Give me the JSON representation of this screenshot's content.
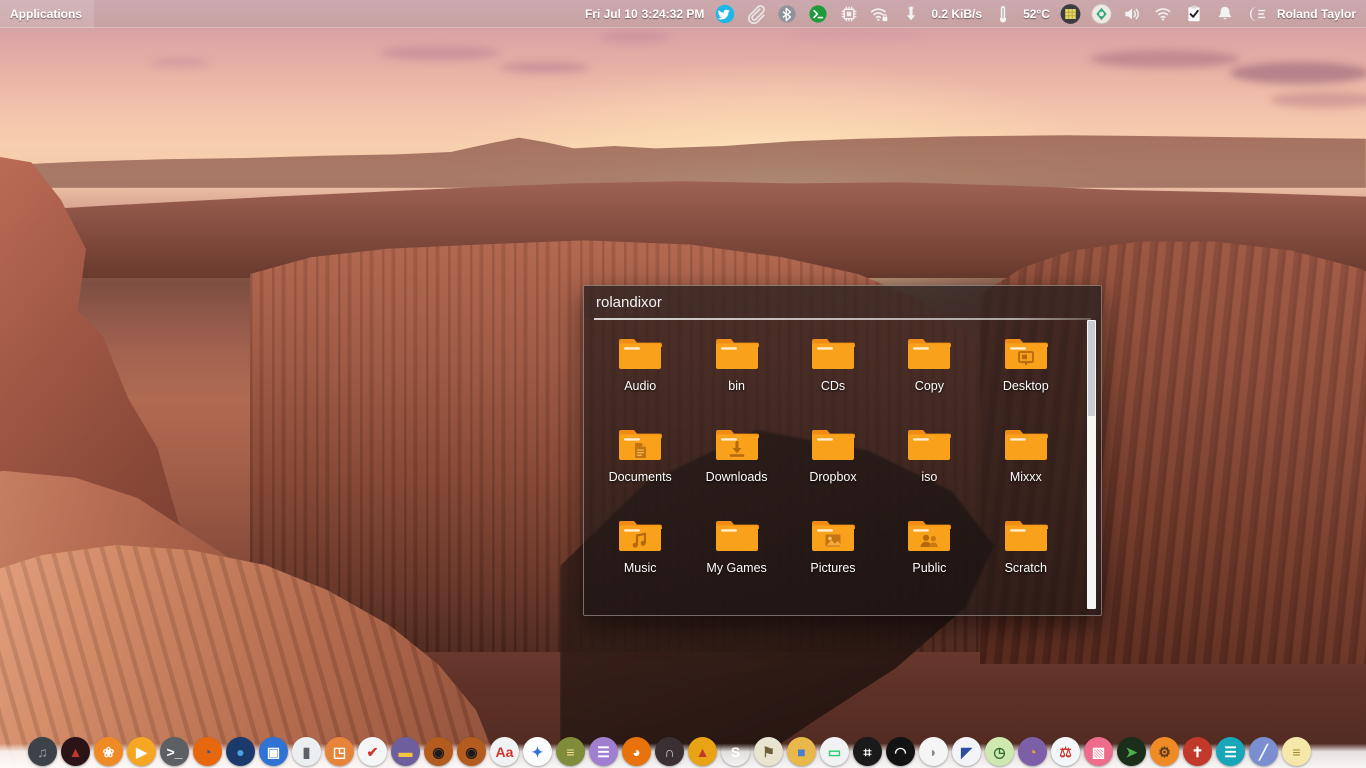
{
  "panel": {
    "applications_label": "Applications",
    "clock_date": "Fri Jul 10",
    "clock_time": "3:24:32 PM",
    "network_rate": "0.2 KiB/s",
    "temperature": "52°C",
    "username": "Roland Taylor",
    "indicators": [
      {
        "name": "twitter-icon",
        "title": "Twitter"
      },
      {
        "name": "paperclip-icon",
        "title": "Clipboard"
      },
      {
        "name": "bluetooth-icon",
        "title": "Bluetooth"
      },
      {
        "name": "terminal-icon",
        "title": "Terminal"
      },
      {
        "name": "cpu-chip-icon",
        "title": "System Load"
      },
      {
        "name": "wifi-lock-icon",
        "title": "Secured Wireless"
      },
      {
        "name": "download-arrow-icon",
        "title": "Network Monitor"
      },
      {
        "name": "thermometer-icon",
        "title": "Temperature"
      },
      {
        "name": "workspace-switcher-icon",
        "title": "Workspaces"
      },
      {
        "name": "update-manager-icon",
        "title": "Updates"
      },
      {
        "name": "volume-icon",
        "title": "Volume"
      },
      {
        "name": "network-icon",
        "title": "Network"
      },
      {
        "name": "clipboard-check-icon",
        "title": "Tasks"
      },
      {
        "name": "bell-icon",
        "title": "Notifications"
      },
      {
        "name": "session-icon",
        "title": "Session Menu"
      }
    ]
  },
  "filemanager": {
    "title": "rolandixor",
    "scrollbar": {
      "thumb_top_pct": 0,
      "thumb_height_pct": 33
    },
    "folder_color": "#f59a1e",
    "folder_color_light": "#fbb040",
    "items": [
      {
        "label": "Audio",
        "icon": "folder-icon",
        "emblem": "none"
      },
      {
        "label": "bin",
        "icon": "folder-icon",
        "emblem": "none"
      },
      {
        "label": "CDs",
        "icon": "folder-icon",
        "emblem": "none"
      },
      {
        "label": "Copy",
        "icon": "folder-icon",
        "emblem": "none"
      },
      {
        "label": "Desktop",
        "icon": "folder-desktop-icon",
        "emblem": "monitor"
      },
      {
        "label": "Documents",
        "icon": "folder-documents-icon",
        "emblem": "document"
      },
      {
        "label": "Downloads",
        "icon": "folder-downloads-icon",
        "emblem": "download"
      },
      {
        "label": "Dropbox",
        "icon": "folder-icon",
        "emblem": "none"
      },
      {
        "label": "iso",
        "icon": "folder-icon",
        "emblem": "none"
      },
      {
        "label": "Mixxx",
        "icon": "folder-icon",
        "emblem": "none"
      },
      {
        "label": "Music",
        "icon": "folder-music-icon",
        "emblem": "note"
      },
      {
        "label": "My Games",
        "icon": "folder-icon",
        "emblem": "none"
      },
      {
        "label": "Pictures",
        "icon": "folder-pictures-icon",
        "emblem": "picture"
      },
      {
        "label": "Public",
        "icon": "folder-public-icon",
        "emblem": "people"
      },
      {
        "label": "Scratch",
        "icon": "folder-icon",
        "emblem": "none"
      }
    ]
  },
  "dock": {
    "items": [
      {
        "name": "dock-item-headphones",
        "label": "Audio Player",
        "bg": "#3c4248",
        "fg": "#8fa4b5",
        "glyph": "♫"
      },
      {
        "name": "dock-item-darkplayer",
        "label": "Media Player",
        "bg": "#2a1418",
        "fg": "#c0392b",
        "glyph": "▲"
      },
      {
        "name": "dock-item-orange",
        "label": "Clementine",
        "bg": "#f08a24",
        "fg": "#ffffff",
        "glyph": "❀"
      },
      {
        "name": "dock-item-play",
        "label": "Video Player",
        "bg": "#f5a623",
        "fg": "#ffffff",
        "glyph": "▶"
      },
      {
        "name": "dock-item-terminal",
        "label": "Terminal",
        "bg": "#5c6065",
        "fg": "#ffffff",
        "glyph": ">_"
      },
      {
        "name": "dock-item-firefox",
        "label": "Firefox",
        "bg": "#e8670c",
        "fg": "#2a5b9e",
        "glyph": "◔"
      },
      {
        "name": "dock-item-blue-orb",
        "label": "Browser",
        "bg": "#1b3a6b",
        "fg": "#4aa3df",
        "glyph": "●"
      },
      {
        "name": "dock-item-filemanager",
        "label": "File Manager",
        "bg": "#2f73d4",
        "fg": "#ffffff",
        "glyph": "▣"
      },
      {
        "name": "dock-item-microphone",
        "label": "Audio Recorder",
        "bg": "#eceff1",
        "fg": "#5d6165",
        "glyph": "▮"
      },
      {
        "name": "dock-item-image-view",
        "label": "Image Viewer",
        "bg": "#e8843a",
        "fg": "#ffffff",
        "glyph": "◳"
      },
      {
        "name": "dock-item-tasks",
        "label": "Task Manager",
        "bg": "#f4f6f7",
        "fg": "#d0352b",
        "glyph": "✔"
      },
      {
        "name": "dock-item-notes",
        "label": "Notes",
        "bg": "#6d5f9e",
        "fg": "#f5c542",
        "glyph": "▬"
      },
      {
        "name": "dock-item-target-a",
        "label": "Recorder",
        "bg": "#b35c1e",
        "fg": "#1a1a1a",
        "glyph": "◉"
      },
      {
        "name": "dock-item-target-b",
        "label": "Screencast",
        "bg": "#b35c1e",
        "fg": "#1a1a1a",
        "glyph": "◉"
      },
      {
        "name": "dock-item-fonts",
        "label": "Font Viewer",
        "bg": "#f0f2f3",
        "fg": "#d0352b",
        "glyph": "Aa"
      },
      {
        "name": "dock-item-colors",
        "label": "Color Picker",
        "bg": "#fbfcfc",
        "fg": "#2f73d4",
        "glyph": "✦"
      },
      {
        "name": "dock-item-spreadsheet",
        "label": "Spreadsheet",
        "bg": "#7f8c3a",
        "fg": "#f6e58d",
        "glyph": "≡"
      },
      {
        "name": "dock-item-writer",
        "label": "Writer",
        "bg": "#a07fd0",
        "fg": "#ffffff",
        "glyph": "☰"
      },
      {
        "name": "dock-item-rss",
        "label": "Feed Reader",
        "bg": "#e8730c",
        "fg": "#ffffff",
        "glyph": "◕"
      },
      {
        "name": "dock-item-headset",
        "label": "Voice Chat",
        "bg": "#3a2f33",
        "fg": "#d0d0d0",
        "glyph": "∩"
      },
      {
        "name": "dock-item-flame",
        "label": "Burner",
        "bg": "#e8a317",
        "fg": "#c0392b",
        "glyph": "▲"
      },
      {
        "name": "dock-item-skype",
        "label": "Skype",
        "bg": "#1cа3e8",
        "fg": "#ffffff",
        "glyph": "S"
      },
      {
        "name": "dock-item-archive",
        "label": "Archive Manager",
        "bg": "#e8e4d0",
        "fg": "#6d5f3a",
        "glyph": "⚑"
      },
      {
        "name": "dock-item-package",
        "label": "Package Manager",
        "bg": "#e8b84a",
        "fg": "#4a7fd0",
        "glyph": "■"
      },
      {
        "name": "dock-item-settings",
        "label": "Settings",
        "bg": "#f0f2f3",
        "fg": "#2ecc71",
        "glyph": "▭"
      },
      {
        "name": "dock-item-apps-grid",
        "label": "Applications",
        "bg": "#1a1a1a",
        "fg": "#ffffff",
        "glyph": "⌗"
      },
      {
        "name": "dock-item-dark-globe",
        "label": "Web",
        "bg": "#121212",
        "fg": "#ffffff",
        "glyph": "◠"
      },
      {
        "name": "dock-item-white-shell",
        "label": "Shell",
        "bg": "#f5f5f5",
        "fg": "#888888",
        "glyph": "◗"
      },
      {
        "name": "dock-item-fan",
        "label": "Graphics",
        "bg": "#f2f4f7",
        "fg": "#2b4f9e",
        "glyph": "◤"
      },
      {
        "name": "dock-item-clock",
        "label": "Clock",
        "bg": "#cfe8b0",
        "fg": "#2f6b2f",
        "glyph": "◷"
      },
      {
        "name": "dock-item-owl",
        "label": "Messenger",
        "bg": "#7d5fa8",
        "fg": "#f5a623",
        "glyph": "◔"
      },
      {
        "name": "dock-item-thermometer",
        "label": "Sensors",
        "bg": "#f4f7f9",
        "fg": "#d0352b",
        "glyph": "⚖"
      },
      {
        "name": "dock-item-pink",
        "label": "Photo Editor",
        "bg": "#ee6d8c",
        "fg": "#ffffff",
        "glyph": "▧"
      },
      {
        "name": "dock-item-green-dark",
        "label": "Text Editor",
        "bg": "#1a2e1a",
        "fg": "#4caf50",
        "glyph": "➤"
      },
      {
        "name": "dock-item-gears",
        "label": "Tweak Tool",
        "bg": "#f08a24",
        "fg": "#5a3a1a",
        "glyph": "⚙"
      },
      {
        "name": "dock-item-cross",
        "label": "Bible Study",
        "bg": "#c0392b",
        "fg": "#ffffff",
        "glyph": "✝"
      },
      {
        "name": "dock-item-doc-teal",
        "label": "Document Viewer",
        "bg": "#19a6b8",
        "fg": "#ffffff",
        "glyph": "☰"
      },
      {
        "name": "dock-item-compass",
        "label": "Drawing",
        "bg": "#7b8fd0",
        "fg": "#f5f5f5",
        "glyph": "╱"
      },
      {
        "name": "dock-item-sticky",
        "label": "Sticky Notes",
        "bg": "#f5e8a8",
        "fg": "#9a8a3a",
        "glyph": "≡"
      }
    ]
  }
}
